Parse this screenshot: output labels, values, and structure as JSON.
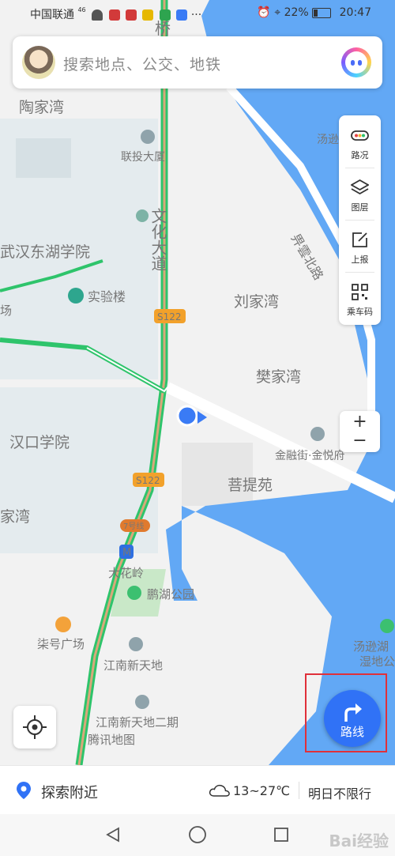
{
  "status_bar": {
    "carrier": "中国联通",
    "signal": "46",
    "battery": "22%",
    "time": "20:47",
    "dots": "···"
  },
  "search": {
    "placeholder": "搜索地点、公交、地铁"
  },
  "tools": [
    {
      "label": "路况",
      "icon": "traffic-icon"
    },
    {
      "label": "图层",
      "icon": "layers-icon"
    },
    {
      "label": "上报",
      "icon": "report-icon"
    },
    {
      "label": "乘车码",
      "icon": "qr-code-icon"
    }
  ],
  "zoom": {
    "in": "+",
    "out": "−"
  },
  "route_button": {
    "label": "路线"
  },
  "bottom": {
    "nearby": "探索附近",
    "weather": "13~27℃",
    "restriction": "明日不限行"
  },
  "map_labels": {
    "bridge": "桥",
    "taojiawan": "陶家湾",
    "liantou": "联投大厦",
    "wenhua": "文化大道",
    "wuhan_donghu": "武汉东湖学院",
    "chang": "场",
    "shiyanlou": "实验楼",
    "s122a": "S122",
    "liujiawan": "刘家湾",
    "fanjiawan": "樊家湾",
    "hankou": "汉口学院",
    "jiawan": "家湾",
    "s122b": "S122",
    "jinrong": "金融街·金悦府",
    "putiyuan": "菩提苑",
    "line7": "7号线",
    "metro": "M",
    "dahualing": "大花岭",
    "penghu": "鹏湖公园",
    "liuhao": "柒号广场",
    "jiangnan": "江南新天地",
    "jiangnan2": "江南新天地二期",
    "tencent": "腾讯地图",
    "tangxun_a": "汤逊",
    "tangxun_b": "汤逊湖",
    "wetland": "湿地公",
    "north_road": "畀雲北路"
  },
  "watermark": "Bai经验",
  "colors": {
    "water": "#62a8f5",
    "road_green": "#2ec46b",
    "accent": "#3072f6",
    "box": "#e0303a"
  }
}
